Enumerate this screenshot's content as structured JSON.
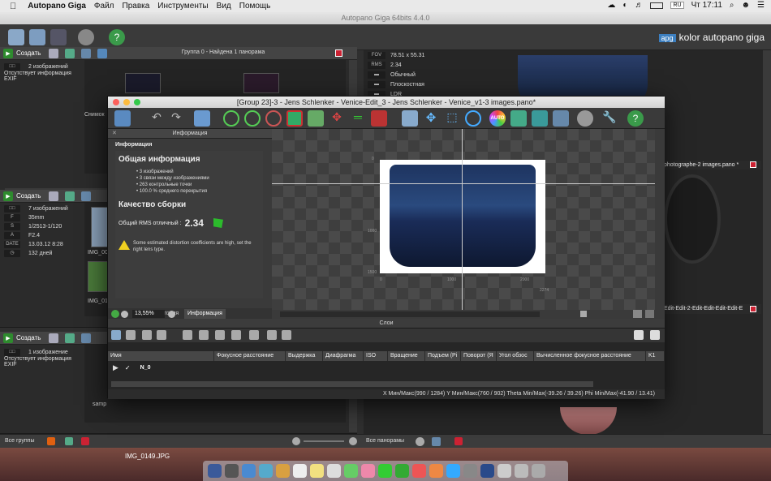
{
  "menubar": {
    "app_name": "Autopano Giga",
    "items": [
      "Файл",
      "Правка",
      "Инструменты",
      "Вид",
      "Помощь"
    ],
    "lang": "RU",
    "clock": "Чт 17:11"
  },
  "main_window": {
    "title": "Autopano Giga 64bits 4.4.0",
    "logo_badge": "apg",
    "logo_text": "kolor autopano giga"
  },
  "groups": [
    {
      "create_label": "Создать",
      "title": "Группа 0 - Найдена 1 панорама",
      "info_lines": [
        "2 изображений",
        "Отсутствует информация EXIF"
      ],
      "thumb_label": "Снимок"
    },
    {
      "create_label": "Создать",
      "info_rows": [
        {
          "key": "",
          "value": "7 изображений"
        },
        {
          "key": "F",
          "value": "35mm"
        },
        {
          "key": "S",
          "value": "1/2513-1/120"
        },
        {
          "key": "A",
          "value": "F2.4"
        },
        {
          "key": "DATE",
          "value": "13.03.12 8:28"
        },
        {
          "key": "",
          "value": "132 дней"
        }
      ],
      "thumb_labels": [
        "IMG_00",
        "IMG_01"
      ]
    },
    {
      "create_label": "Создать",
      "info_lines": [
        "1 изображение",
        "Отсутствует информация EXIF"
      ],
      "thumb_label": "samp"
    }
  ],
  "right_panel": {
    "props": [
      {
        "key": "FOV",
        "value": "78.51 x 55.31"
      },
      {
        "key": "RMS",
        "value": "2.34"
      },
      {
        "key": "",
        "value": "Обычный"
      },
      {
        "key": "",
        "value": "Плоскостная"
      },
      {
        "key": "",
        "value": "LDR"
      }
    ],
    "pano2_title": "photographe-2 images.pano *",
    "pano3_title": "Edit-Edit-2-Edit-Edit-Edit-Edit-E"
  },
  "bottom_bar": {
    "all_groups": "Все группы",
    "all_panos": "Все панорамы",
    "desktop_file": "IMG_0149.JPG"
  },
  "editor": {
    "title": "[Group 23]-3 - Jens Schlenker - Venice-Edit_3 - Jens Schlenker - Venice_v1-3 images.pano*",
    "info_panel_title": "Информация",
    "info_header": "Информация",
    "general_title": "Общая информация",
    "bullets": [
      "3 изображений",
      "3 связи между изображениями",
      "263 контрольные точки",
      "100.0 % среднего перекрытия"
    ],
    "quality_title": "Качество сборки",
    "rms_label": "Общий RMS отличный :",
    "rms_value": "2.34",
    "warning": "Some estimated distortion coefficients are high, set the right lens type.",
    "tabs": [
      "История",
      "Информация"
    ],
    "zoom": "13,55%",
    "ruler_labels": [
      "0",
      "1000",
      "2000",
      "2274"
    ],
    "ruler_v_labels": [
      "0",
      "1000",
      "1500"
    ],
    "layers_title": "Слои",
    "columns": [
      "Имя",
      "Фокусное расстояние",
      "Выдержка",
      "Диафрагма",
      "ISO",
      "Вращение",
      "Подъем (Pi",
      "Поворот (Я",
      "Угол обзос",
      "Вычисленное фокусное расстояние",
      "K1"
    ],
    "layer_name": "N_0",
    "status": "X Мин/Макс(990 / 1284)   Y Мин/Макс(760 / 902)   Theta Min/Max(-39.26 / 39.26)   Phi Min/Max(-41.90 / 13.41)"
  }
}
